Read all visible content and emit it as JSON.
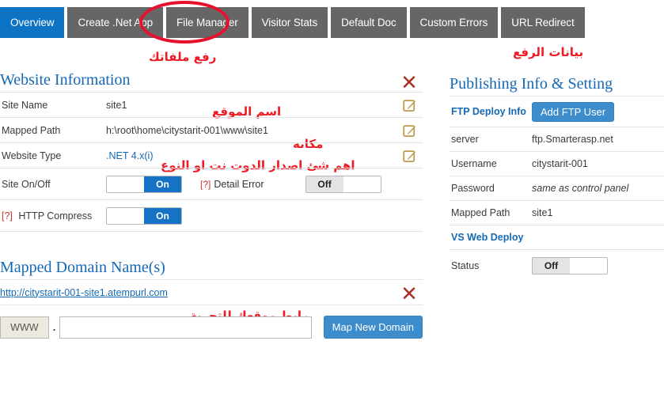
{
  "tabs": [
    {
      "label": "Overview",
      "active": true
    },
    {
      "label": "Create .Net App",
      "active": false
    },
    {
      "label": "File Manager",
      "active": false
    },
    {
      "label": "Visitor Stats",
      "active": false
    },
    {
      "label": "Default Doc",
      "active": false
    },
    {
      "label": "Custom Errors",
      "active": false
    },
    {
      "label": "URL Redirect",
      "active": false
    }
  ],
  "annotations": {
    "upload_files": "رفع ملفاتك",
    "publish_data": "بيانات الرفع",
    "site_name": "اسم الموقع",
    "mapped_path": "مكانه",
    "website_type": "اهم شئ اصدار الدوت نت  او النوع",
    "site_link": "رابط موقعك للتجربة",
    "circle_target": "File Manager"
  },
  "website_information": {
    "title": "Website Information",
    "close_icon": "close-icon",
    "rows": [
      {
        "label": "Site Name",
        "value": "site1",
        "style": "plain",
        "edit": true
      },
      {
        "label": "Mapped Path",
        "value": "h:\\root\\home\\citystarit-001\\www\\site1",
        "style": "plain",
        "edit": true
      },
      {
        "label": "Website Type",
        "value": ".NET 4.x(i)",
        "style": "link",
        "edit": true
      }
    ],
    "toggles": {
      "site_on_off": {
        "label": "Site On/Off",
        "state": "On"
      },
      "detail_error": {
        "label": "Detail Error",
        "hint": "[?]",
        "state": "Off"
      },
      "http_compress": {
        "label": "HTTP Compress",
        "hint": "[?]",
        "state": "On"
      }
    }
  },
  "mapped_domains": {
    "title": "Mapped Domain Name(s)",
    "existing_domain": "http://citystarit-001-site1.atempurl.com",
    "close_icon": "close-icon",
    "www_label": "WWW",
    "dot": ".",
    "input_value": "",
    "input_placeholder": "",
    "map_button": "Map New Domain"
  },
  "publishing": {
    "title": "Publishing Info & Setting",
    "ftp_deploy_label": "FTP Deploy Info",
    "add_ftp_button": "Add FTP User",
    "rows": [
      {
        "label": "server",
        "value": "ftp.Smarterasp.net",
        "style": "plain"
      },
      {
        "label": "Username",
        "value": "citystarit-001",
        "style": "plain"
      },
      {
        "label": "Password",
        "value": "same as control panel",
        "style": "italic"
      },
      {
        "label": "Mapped Path",
        "value": "site1",
        "style": "plain"
      }
    ],
    "vs_web_deploy_label": "VS Web Deploy",
    "status": {
      "label": "Status",
      "state": "Off"
    }
  },
  "colors": {
    "tab_active": "#0d73c4",
    "tab_inactive": "#666666",
    "heading_blue": "#1569b4",
    "annotation_red": "#ee1b24",
    "circle_red": "#e8112d",
    "toggle_on": "#1572c4",
    "toggle_off": "#e4e4e4",
    "button_blue": "#3d8dcc",
    "edit_icon_gold": "#bd9b4f",
    "close_icon_red": "#a93226"
  }
}
